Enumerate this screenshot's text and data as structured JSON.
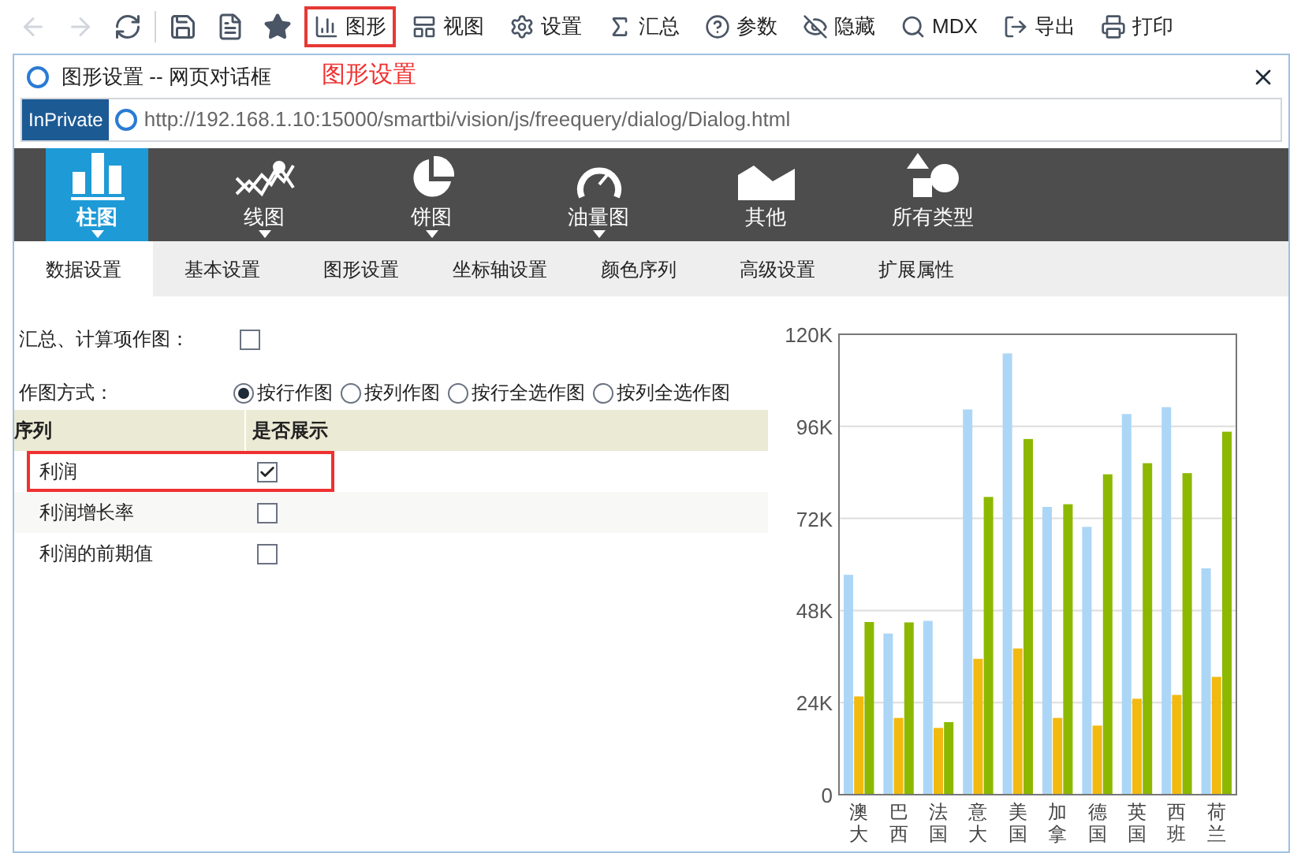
{
  "toolbar": {
    "items": [
      {
        "label": "图形",
        "highlighted": true
      },
      {
        "label": "视图",
        "highlighted": false
      },
      {
        "label": "设置",
        "highlighted": false
      },
      {
        "label": "汇总",
        "highlighted": false
      },
      {
        "label": "参数",
        "highlighted": false
      },
      {
        "label": "隐藏",
        "highlighted": false
      },
      {
        "label": "MDX",
        "highlighted": false
      },
      {
        "label": "导出",
        "highlighted": false
      },
      {
        "label": "打印",
        "highlighted": false
      }
    ]
  },
  "dialog": {
    "title": "图形设置 -- 网页对话框",
    "annotation": "图形设置",
    "inprivate": "InPrivate",
    "url": "http://192.168.1.10:15000/smartbi/vision/js/freequery/dialog/Dialog.html"
  },
  "chart_types": [
    {
      "label": "柱图",
      "selected": true,
      "has_menu": true
    },
    {
      "label": "线图",
      "selected": false,
      "has_menu": true
    },
    {
      "label": "饼图",
      "selected": false,
      "has_menu": true
    },
    {
      "label": "油量图",
      "selected": false,
      "has_menu": true
    },
    {
      "label": "其他",
      "selected": false,
      "has_menu": false
    },
    {
      "label": "所有类型",
      "selected": false,
      "has_menu": false
    }
  ],
  "tabs": [
    {
      "label": "数据设置",
      "selected": true
    },
    {
      "label": "基本设置",
      "selected": false
    },
    {
      "label": "图形设置",
      "selected": false
    },
    {
      "label": "坐标轴设置",
      "selected": false
    },
    {
      "label": "颜色序列",
      "selected": false
    },
    {
      "label": "高级设置",
      "selected": false
    },
    {
      "label": "扩展属性",
      "selected": false
    }
  ],
  "summary_option": {
    "label": "汇总、计算项作图：",
    "checked": false
  },
  "plot_mode": {
    "label": "作图方式：",
    "options": [
      {
        "label": "按行作图",
        "selected": true
      },
      {
        "label": "按列作图",
        "selected": false
      },
      {
        "label": "按行全选作图",
        "selected": false
      },
      {
        "label": "按列全选作图",
        "selected": false
      }
    ]
  },
  "series_table": {
    "columns": [
      "序列",
      "是否展示"
    ],
    "rows": [
      {
        "name": "利润",
        "checked": true,
        "highlighted": true
      },
      {
        "name": "利润增长率",
        "checked": false,
        "highlighted": false
      },
      {
        "name": "利润的前期值",
        "checked": false,
        "highlighted": false
      }
    ]
  },
  "chart_data": {
    "type": "bar",
    "grid": true,
    "categories": [
      "澳大",
      "巴西",
      "法国",
      "意大",
      "美国",
      "加拿",
      "德国",
      "英国",
      "西班",
      "荷兰"
    ],
    "ylim": [
      0,
      120000
    ],
    "yticks": [
      {
        "value": 0,
        "label": "0"
      },
      {
        "value": 24000,
        "label": "24K"
      },
      {
        "value": 48000,
        "label": "48K"
      },
      {
        "value": 72000,
        "label": "72K"
      },
      {
        "value": 96000,
        "label": "96K"
      },
      {
        "value": 120000,
        "label": "120K"
      }
    ],
    "series": [
      {
        "color": "#acd6f6",
        "values": [
          57300,
          42000,
          45300,
          100400,
          115000,
          75000,
          69800,
          99200,
          101000,
          59000
        ]
      },
      {
        "color": "#f2b90f",
        "values": [
          25600,
          20000,
          17400,
          35400,
          38100,
          20000,
          18000,
          25000,
          26000,
          30700
        ]
      },
      {
        "color": "#8cb800",
        "values": [
          45000,
          44900,
          18900,
          77600,
          92700,
          75700,
          83500,
          86400,
          83800,
          94600
        ]
      }
    ]
  }
}
